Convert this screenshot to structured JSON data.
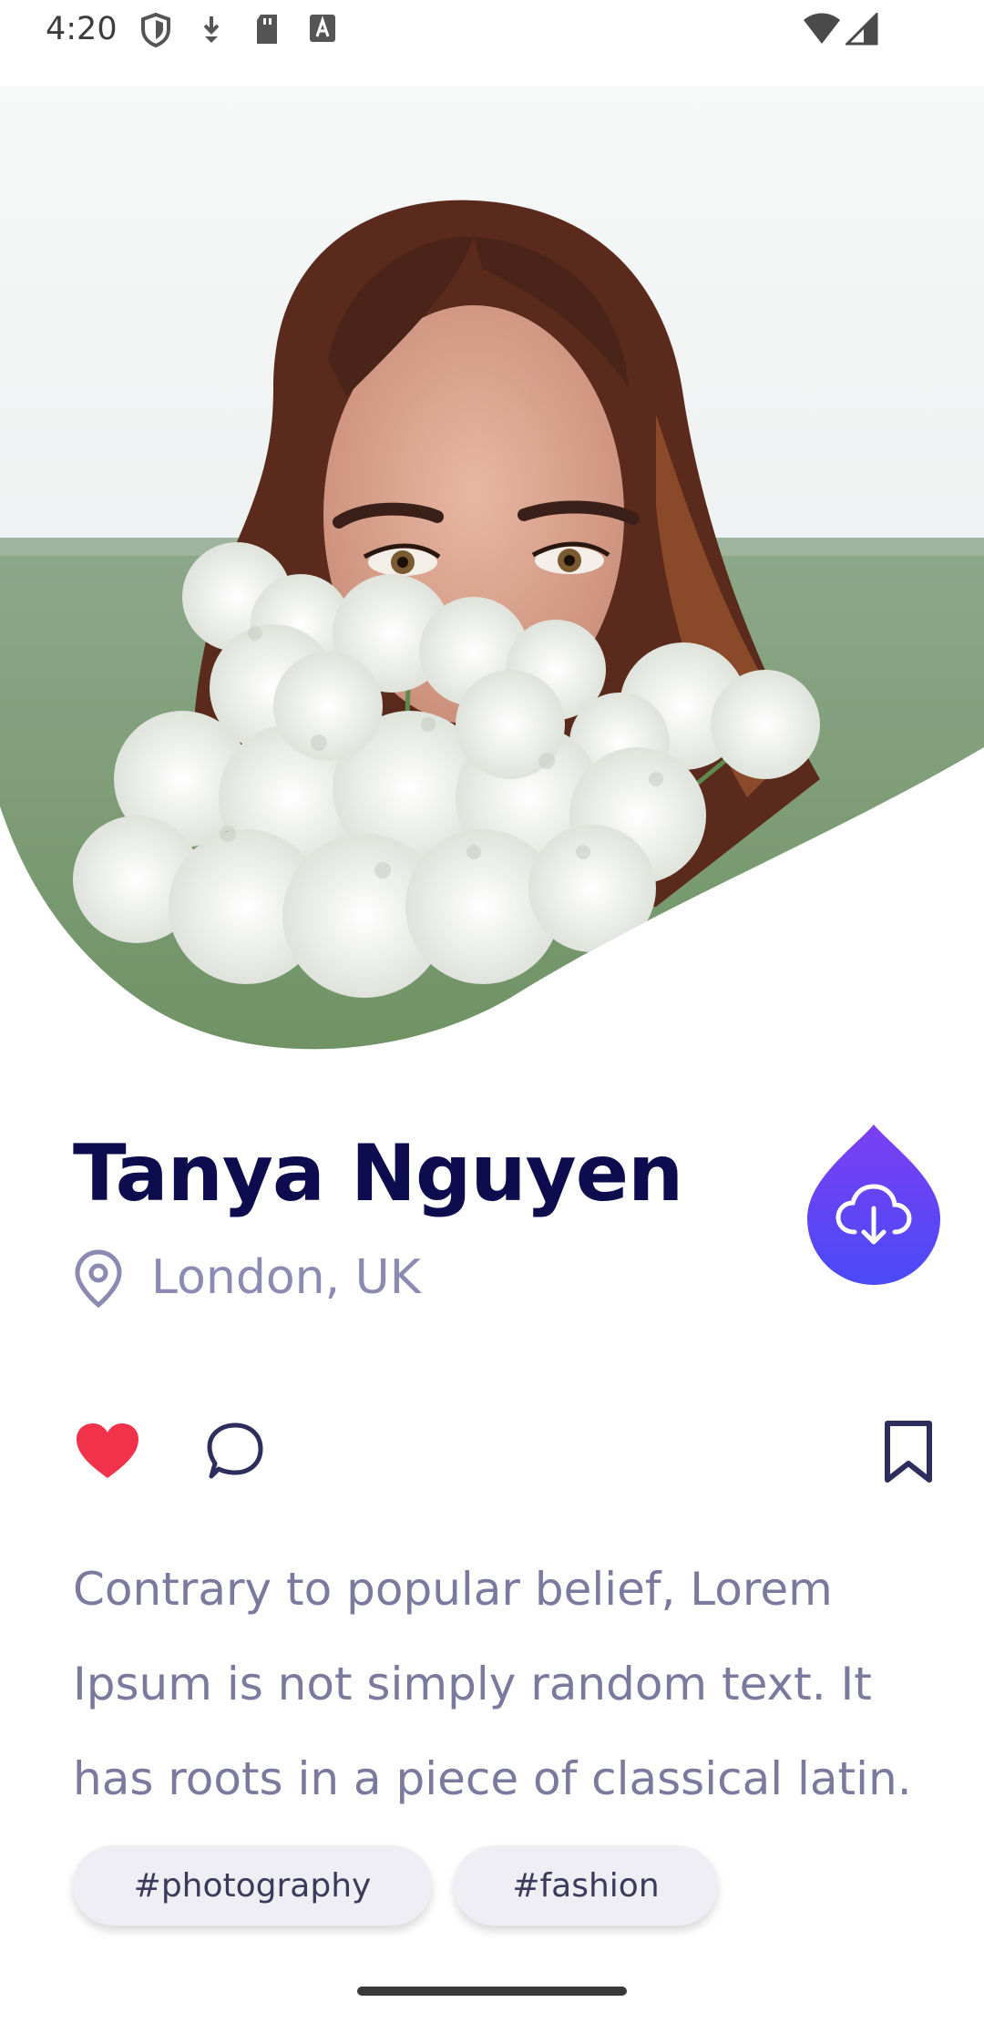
{
  "status_bar": {
    "time": "4:20",
    "icons": [
      "shield-icon",
      "download-arrow-icon",
      "sd-card-icon",
      "text-a-icon",
      "wifi-icon",
      "signal-icon"
    ]
  },
  "hero": {
    "image_subject": "woman holding white baby's breath flowers in a green field"
  },
  "profile": {
    "name": "Tanya Nguyen",
    "location": "London, UK"
  },
  "actions": {
    "download_icon": "cloud-download-icon",
    "like_icon": "heart-icon",
    "comment_icon": "speech-bubble-icon",
    "bookmark_icon": "bookmark-icon"
  },
  "description": "Contrary to popular belief, Lorem Ipsum is not simply random text. It has roots in a piece of classical latin.",
  "tags": [
    "#photography",
    "#fashion"
  ],
  "colors": {
    "name": "#0c0c4e",
    "muted_text": "#8b8ab2",
    "like": "#f0324a",
    "accent_top": "#7b3ff2",
    "accent_bottom": "#4a4af8",
    "tag_bg": "#eeeef4"
  }
}
